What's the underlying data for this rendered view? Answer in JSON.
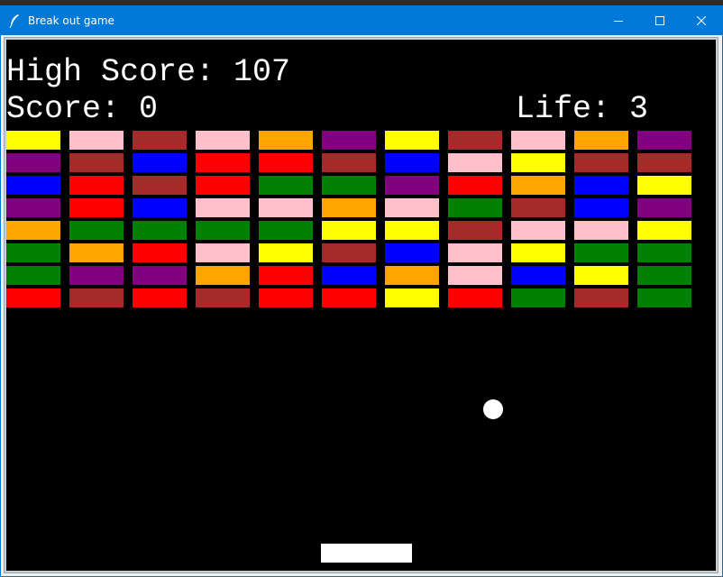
{
  "window": {
    "title": "Break out game",
    "titlebar_color": "#0078d7",
    "icons": [
      "feather-app-icon",
      "minimize-icon",
      "maximize-icon",
      "close-icon"
    ]
  },
  "hud": {
    "high_score": "High Score: 107",
    "score": "Score: 0",
    "life": "Life: 3"
  },
  "game": {
    "background": "#000000",
    "ball_color": "#ffffff",
    "paddle_color": "#ffffff",
    "palette": {
      "Y": "#ffff00",
      "P": "#ffc0cb",
      "B": "#a52a2a",
      "O": "#ffa500",
      "V": "#800080",
      "U": "#0000ff",
      "R": "#ff0000",
      "G": "#008000"
    },
    "bricks": [
      [
        "Y",
        "P",
        "B",
        "P",
        "O",
        "V",
        "Y",
        "B",
        "P",
        "O",
        "V"
      ],
      [
        "V",
        "B",
        "U",
        "R",
        "R",
        "B",
        "U",
        "P",
        "Y",
        "B",
        "B"
      ],
      [
        "U",
        "R",
        "B",
        "R",
        "G",
        "G",
        "V",
        "R",
        "O",
        "U",
        "Y"
      ],
      [
        "V",
        "R",
        "U",
        "P",
        "P",
        "O",
        "P",
        "G",
        "B",
        "U",
        "V"
      ],
      [
        "O",
        "G",
        "G",
        "G",
        "G",
        "Y",
        "Y",
        "B",
        "P",
        "P",
        "Y"
      ],
      [
        "G",
        "O",
        "R",
        "P",
        "Y",
        "B",
        "U",
        "P",
        "Y",
        "G",
        "G"
      ],
      [
        "G",
        "V",
        "V",
        "O",
        "R",
        "U",
        "O",
        "P",
        "U",
        "Y",
        "G"
      ],
      [
        "R",
        "B",
        "R",
        "B",
        "R",
        "R",
        "Y",
        "R",
        "G",
        "B",
        "G"
      ]
    ]
  }
}
